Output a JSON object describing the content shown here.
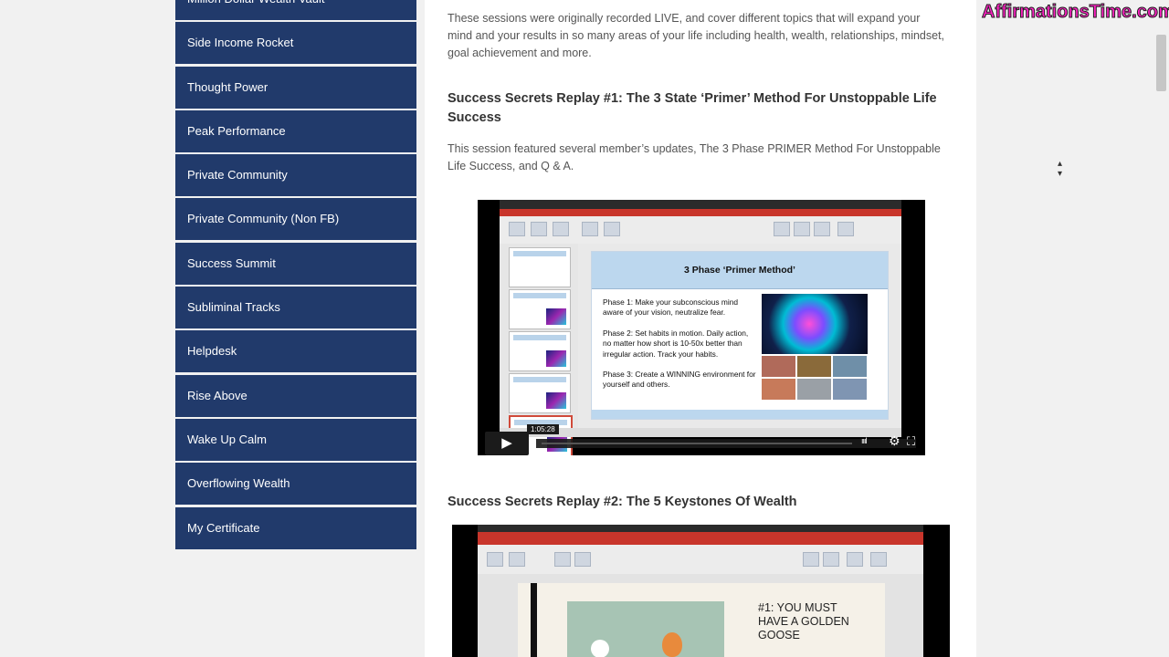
{
  "sidebar": {
    "items": [
      {
        "label": "Million Dollar Wealth Vault"
      },
      {
        "label": "Side Income Rocket"
      },
      {
        "label": "Thought Power"
      },
      {
        "label": "Peak Performance"
      },
      {
        "label": "Private Community"
      },
      {
        "label": "Private Community (Non FB)"
      },
      {
        "label": "Success Summit"
      },
      {
        "label": "Subliminal Tracks"
      },
      {
        "label": "Helpdesk"
      },
      {
        "label": "Rise Above"
      },
      {
        "label": "Wake Up Calm"
      },
      {
        "label": "Overflowing Wealth"
      },
      {
        "label": "My Certificate"
      }
    ]
  },
  "main": {
    "intro": "These sessions were originally recorded LIVE, and cover different topics that will expand your mind and your results in so many areas of your life including health, wealth, relationships, mindset, goal achievement and more.",
    "replay1": {
      "title": "Success Secrets Replay #1: The 3 State ‘Primer’ Method For Unstoppable Life Success",
      "description": "This session featured several member’s updates, The 3 Phase PRIMER Method For Unstoppable Life Success, and Q & A.",
      "video": {
        "slide_title": "3 Phase ‘Primer Method’",
        "phase1": "Phase 1: Make your subconscious mind aware of your vision, neutralize fear.",
        "phase2": "Phase 2: Set habits in motion. Daily action, no matter how short is 10-50x better than irregular action. Track your habits.",
        "phase3": "Phase 3: Create a WINNING environment for yourself and others.",
        "timecode": "1:05:28",
        "play_icon": "▶",
        "settings_icon": "⚙",
        "fullscreen_icon": "⛶"
      }
    },
    "replay2": {
      "title": "Success Secrets Replay #2: The 5 Keystones Of Wealth",
      "video": {
        "slide_line1": "#1: YOU MUST",
        "slide_line2": "HAVE A GOLDEN",
        "slide_line3": "GOOSE"
      }
    }
  },
  "watermark": "AffirmationsTime.com"
}
